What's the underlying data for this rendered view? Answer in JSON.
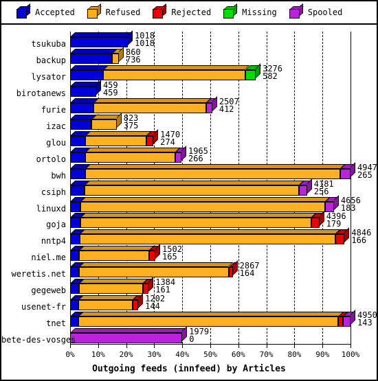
{
  "legend": {
    "items": [
      {
        "label": "Accepted",
        "color": "#0000dd",
        "icon": "cube-icon"
      },
      {
        "label": "Refused",
        "color": "#ffb020",
        "icon": "cube-icon"
      },
      {
        "label": "Rejected",
        "color": "#ee0000",
        "icon": "cube-icon"
      },
      {
        "label": "Missing",
        "color": "#00dd00",
        "icon": "cube-icon"
      },
      {
        "label": "Spooled",
        "color": "#bb22dd",
        "icon": "cube-icon"
      }
    ]
  },
  "chart_data": {
    "type": "bar",
    "orientation": "horizontal",
    "stacked": true,
    "title": "Outgoing feeds (innfeed) by Articles",
    "xlabel": "Outgoing feeds (innfeed) by Articles",
    "ylabel": "",
    "xlim": [
      0,
      100
    ],
    "xunit": "%",
    "grid": true,
    "legend_position": "top",
    "xticks": [
      "0%",
      "10%",
      "20%",
      "30%",
      "40%",
      "50%",
      "60%",
      "70%",
      "80%",
      "90%",
      "100%"
    ],
    "xtickvalues": [
      0,
      10,
      20,
      30,
      40,
      50,
      60,
      70,
      80,
      90,
      100
    ],
    "categories": [
      "tsukuba",
      "backup",
      "lysator",
      "birotanews",
      "furie",
      "izac",
      "glou",
      "ortolo",
      "bwh",
      "csiph",
      "linuxd",
      "goja",
      "nntp4",
      "niel.me",
      "weretis.net",
      "gegeweb",
      "usenet-fr",
      "tnet",
      "bete-des-vosges"
    ],
    "series": [
      {
        "name": "Accepted",
        "color": "#0000dd",
        "values": [
          1018,
          736,
          582,
          459,
          412,
          375,
          274,
          266,
          265,
          256,
          183,
          179,
          166,
          165,
          164,
          161,
          144,
          143,
          0
        ]
      },
      {
        "name": "Refused",
        "color": "#ffb020",
        "values": [
          0,
          124,
          2506,
          0,
          1993,
          448,
          1080,
          1587,
          4497,
          3785,
          4318,
          4076,
          4516,
          1235,
          2629,
          1129,
          961,
          4594,
          0
        ]
      },
      {
        "name": "Rejected",
        "color": "#ee0000",
        "values": [
          0,
          0,
          0,
          0,
          0,
          0,
          116,
          0,
          0,
          0,
          0,
          141,
          164,
          102,
          74,
          94,
          97,
          81,
          0
        ]
      },
      {
        "name": "Missing",
        "color": "#00dd00",
        "values": [
          0,
          0,
          188,
          0,
          0,
          0,
          0,
          0,
          0,
          0,
          0,
          0,
          0,
          0,
          0,
          0,
          0,
          0,
          0
        ]
      },
      {
        "name": "Spooled",
        "color": "#bb22dd",
        "values": [
          0,
          0,
          0,
          0,
          102,
          0,
          0,
          112,
          185,
          140,
          155,
          0,
          0,
          0,
          0,
          0,
          0,
          132,
          1979
        ]
      }
    ],
    "rows": [
      {
        "label": "tsukuba",
        "total": 1018,
        "accepted": 1018,
        "pct": 20.6,
        "segments": [
          {
            "name": "Accepted",
            "color": "#0000dd",
            "pct": 20.6
          }
        ]
      },
      {
        "label": "backup",
        "total": 860,
        "accepted": 736,
        "pct": 17.4,
        "segments": [
          {
            "name": "Accepted",
            "color": "#0000dd",
            "pct": 14.9
          },
          {
            "name": "Refused",
            "color": "#ffb020",
            "pct": 2.5
          }
        ]
      },
      {
        "label": "lysator",
        "total": 3276,
        "accepted": 582,
        "pct": 66.2,
        "segments": [
          {
            "name": "Accepted",
            "color": "#0000dd",
            "pct": 11.8
          },
          {
            "name": "Refused",
            "color": "#ffb020",
            "pct": 50.6
          },
          {
            "name": "Missing",
            "color": "#00dd00",
            "pct": 3.8
          }
        ]
      },
      {
        "label": "birotanews",
        "total": 459,
        "accepted": 459,
        "pct": 9.3,
        "segments": [
          {
            "name": "Accepted",
            "color": "#0000dd",
            "pct": 9.3
          }
        ]
      },
      {
        "label": "furie",
        "total": 2507,
        "accepted": 412,
        "pct": 50.7,
        "segments": [
          {
            "name": "Accepted",
            "color": "#0000dd",
            "pct": 8.3
          },
          {
            "name": "Refused",
            "color": "#ffb020",
            "pct": 40.3
          },
          {
            "name": "Spooled",
            "color": "#bb22dd",
            "pct": 2.1
          }
        ]
      },
      {
        "label": "izac",
        "total": 823,
        "accepted": 375,
        "pct": 16.6,
        "segments": [
          {
            "name": "Accepted",
            "color": "#0000dd",
            "pct": 7.6
          },
          {
            "name": "Refused",
            "color": "#ffb020",
            "pct": 9.0
          }
        ]
      },
      {
        "label": "glou",
        "total": 1470,
        "accepted": 274,
        "pct": 29.7,
        "segments": [
          {
            "name": "Accepted",
            "color": "#0000dd",
            "pct": 5.5
          },
          {
            "name": "Refused",
            "color": "#ffb020",
            "pct": 21.8
          },
          {
            "name": "Rejected",
            "color": "#ee0000",
            "pct": 2.4
          }
        ]
      },
      {
        "label": "ortolo",
        "total": 1965,
        "accepted": 266,
        "pct": 39.7,
        "segments": [
          {
            "name": "Accepted",
            "color": "#0000dd",
            "pct": 5.4
          },
          {
            "name": "Refused",
            "color": "#ffb020",
            "pct": 32.1
          },
          {
            "name": "Spooled",
            "color": "#bb22dd",
            "pct": 2.2
          }
        ]
      },
      {
        "label": "bwh",
        "total": 4947,
        "accepted": 265,
        "pct": 100.0,
        "segments": [
          {
            "name": "Accepted",
            "color": "#0000dd",
            "pct": 5.4
          },
          {
            "name": "Refused",
            "color": "#ffb020",
            "pct": 90.9
          },
          {
            "name": "Spooled",
            "color": "#bb22dd",
            "pct": 3.7
          }
        ]
      },
      {
        "label": "csiph",
        "total": 4181,
        "accepted": 256,
        "pct": 84.5,
        "segments": [
          {
            "name": "Accepted",
            "color": "#0000dd",
            "pct": 5.2
          },
          {
            "name": "Refused",
            "color": "#ffb020",
            "pct": 76.5
          },
          {
            "name": "Spooled",
            "color": "#bb22dd",
            "pct": 2.8
          }
        ]
      },
      {
        "label": "linuxd",
        "total": 4656,
        "accepted": 183,
        "pct": 94.1,
        "segments": [
          {
            "name": "Accepted",
            "color": "#0000dd",
            "pct": 3.7
          },
          {
            "name": "Refused",
            "color": "#ffb020",
            "pct": 87.3
          },
          {
            "name": "Spooled",
            "color": "#bb22dd",
            "pct": 3.1
          }
        ]
      },
      {
        "label": "goja",
        "total": 4396,
        "accepted": 179,
        "pct": 88.9,
        "segments": [
          {
            "name": "Accepted",
            "color": "#0000dd",
            "pct": 3.6
          },
          {
            "name": "Refused",
            "color": "#ffb020",
            "pct": 82.4
          },
          {
            "name": "Rejected",
            "color": "#ee0000",
            "pct": 2.9
          }
        ]
      },
      {
        "label": "nntp4",
        "total": 4846,
        "accepted": 166,
        "pct": 97.9,
        "segments": [
          {
            "name": "Accepted",
            "color": "#0000dd",
            "pct": 3.4
          },
          {
            "name": "Refused",
            "color": "#ffb020",
            "pct": 91.2
          },
          {
            "name": "Rejected",
            "color": "#ee0000",
            "pct": 3.3
          }
        ]
      },
      {
        "label": "niel.me",
        "total": 1502,
        "accepted": 165,
        "pct": 30.4,
        "segments": [
          {
            "name": "Accepted",
            "color": "#0000dd",
            "pct": 3.3
          },
          {
            "name": "Refused",
            "color": "#ffb020",
            "pct": 25.0
          },
          {
            "name": "Rejected",
            "color": "#ee0000",
            "pct": 2.1
          }
        ]
      },
      {
        "label": "weretis.net",
        "total": 2867,
        "accepted": 164,
        "pct": 58.0,
        "segments": [
          {
            "name": "Accepted",
            "color": "#0000dd",
            "pct": 3.3
          },
          {
            "name": "Refused",
            "color": "#ffb020",
            "pct": 53.2
          },
          {
            "name": "Rejected",
            "color": "#ee0000",
            "pct": 1.5
          }
        ]
      },
      {
        "label": "gegeweb",
        "total": 1384,
        "accepted": 161,
        "pct": 28.0,
        "segments": [
          {
            "name": "Accepted",
            "color": "#0000dd",
            "pct": 3.3
          },
          {
            "name": "Refused",
            "color": "#ffb020",
            "pct": 22.8
          },
          {
            "name": "Rejected",
            "color": "#ee0000",
            "pct": 1.9
          }
        ]
      },
      {
        "label": "usenet-fr",
        "total": 1202,
        "accepted": 144,
        "pct": 24.3,
        "segments": [
          {
            "name": "Accepted",
            "color": "#0000dd",
            "pct": 2.9
          },
          {
            "name": "Refused",
            "color": "#ffb020",
            "pct": 19.4
          },
          {
            "name": "Rejected",
            "color": "#ee0000",
            "pct": 2.0
          }
        ]
      },
      {
        "label": "tnet",
        "total": 4950,
        "accepted": 143,
        "pct": 100.0,
        "segments": [
          {
            "name": "Accepted",
            "color": "#0000dd",
            "pct": 2.9
          },
          {
            "name": "Refused",
            "color": "#ffb020",
            "pct": 92.8
          },
          {
            "name": "Rejected",
            "color": "#ee0000",
            "pct": 1.6
          },
          {
            "name": "Spooled",
            "color": "#bb22dd",
            "pct": 2.7
          }
        ]
      },
      {
        "label": "bete-des-vosges",
        "total": 1979,
        "accepted": 0,
        "pct": 40.0,
        "segments": [
          {
            "name": "Spooled",
            "color": "#bb22dd",
            "pct": 40.0
          }
        ]
      }
    ]
  }
}
